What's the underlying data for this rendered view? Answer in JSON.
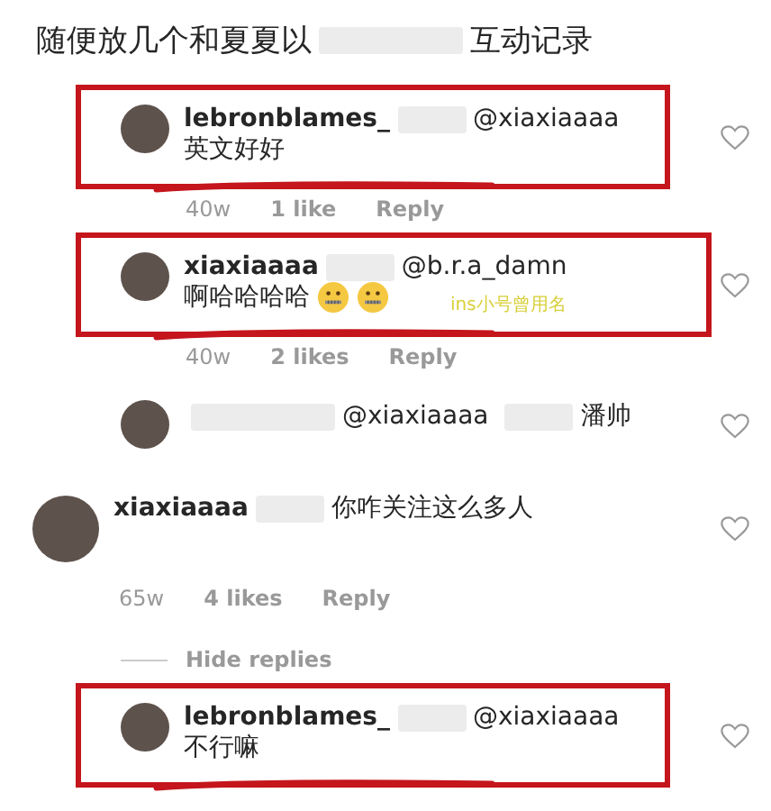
{
  "heading": {
    "before": "随便放几个和夏夏以",
    "redacted": true,
    "after": "互动记录"
  },
  "comments": [
    {
      "kind": "reply",
      "highlighted": true,
      "username": "lebronblames_",
      "redacted": true,
      "mention": "@xiaxiaaaa",
      "text": "英文好好",
      "meta": {
        "time": "40w",
        "likes": "1 like",
        "reply": "Reply"
      }
    },
    {
      "kind": "reply",
      "highlighted": true,
      "username": "xiaxiaaaa",
      "redacted": true,
      "mention": "@b.r.a_damn",
      "text": "啊哈哈哈哈",
      "emojis": [
        {
          "kind": "zipper-mouth"
        },
        {
          "kind": "zipper-mouth"
        }
      ],
      "note": "ins小号曾用名",
      "meta": {
        "time": "40w",
        "likes": "2 likes",
        "reply": "Reply"
      }
    },
    {
      "kind": "reply",
      "highlighted": false,
      "redacted": true,
      "mention": "@xiaxiaaaa",
      "redacted_after": true,
      "text": "潘帅"
    },
    {
      "kind": "top",
      "highlighted": false,
      "username": "xiaxiaaaa",
      "redacted": true,
      "text": "你咋关注这么多人",
      "meta": {
        "time": "65w",
        "likes": "4 likes",
        "reply": "Reply"
      }
    },
    {
      "kind": "hide",
      "label": "Hide replies"
    },
    {
      "kind": "reply",
      "highlighted": true,
      "username": "lebronblames_",
      "redacted": true,
      "mention": "@xiaxiaaaa",
      "text": "不行嘛"
    }
  ]
}
